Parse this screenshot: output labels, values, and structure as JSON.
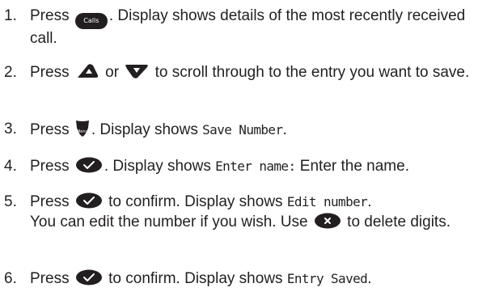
{
  "steps": [
    {
      "num": "1.",
      "press": "Press",
      "button_label": "Calls",
      "text": ". Display shows details of the most recently received call."
    },
    {
      "num": "2.",
      "press": "Press",
      "or": "or",
      "text": "to scroll through to the entry you want to save."
    },
    {
      "num": "3.",
      "press": "Press",
      "button_label": "Menu",
      "text1": ". Display shows ",
      "lcd": "Save Number",
      "text2": "."
    },
    {
      "num": "4.",
      "press": "Press",
      "text1": ".  Display shows ",
      "lcd": "Enter name:",
      "text2": " Enter the name."
    },
    {
      "num": "5.",
      "press": "Press",
      "text1": "to confirm. Display shows ",
      "lcd": "Edit number",
      "text2": ".",
      "text3": "You can edit the number if you wish. Use",
      "text4": "to delete digits."
    },
    {
      "num": "6.",
      "press": "Press",
      "text1": "to confirm. Display shows ",
      "lcd": "Entry Saved",
      "text2": "."
    }
  ],
  "colors": {
    "text": "#231f20",
    "button": "#231f20",
    "button_glyph": "#ffffff"
  }
}
